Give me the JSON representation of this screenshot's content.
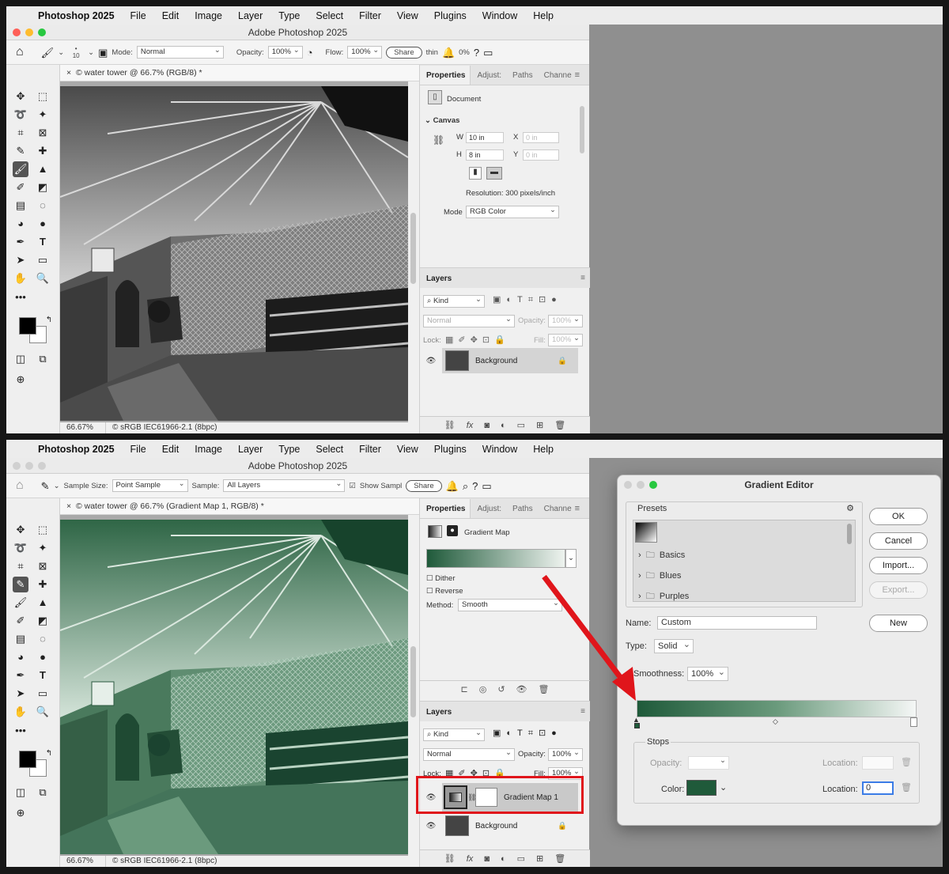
{
  "menubar": {
    "app_name": "Photoshop 2025",
    "items": [
      "File",
      "Edit",
      "Image",
      "Layer",
      "Type",
      "Select",
      "Filter",
      "View",
      "Plugins",
      "Window",
      "Help"
    ]
  },
  "window": {
    "title": "Adobe Photoshop 2025"
  },
  "top": {
    "options": {
      "brush_size": "10",
      "mode_label": "Mode:",
      "mode_value": "Normal",
      "opacity_label": "Opacity:",
      "opacity_value": "100%",
      "flow_label": "Flow:",
      "flow_value": "100%",
      "share": "Share",
      "thin_text": "thin",
      "smoothing_value": "0%"
    },
    "doc_tab": "© water tower @ 66.7% (RGB/8) *",
    "status": {
      "zoom": "66.67%",
      "profile": "© sRGB IEC61966-2.1 (8bpc)"
    },
    "panel_tabs": [
      "Properties",
      "Adjust:",
      "Paths",
      "Channe"
    ],
    "properties": {
      "document_label": "Document",
      "canvas_label": "Canvas",
      "w_label": "W",
      "w_value": "10 in",
      "h_label": "H",
      "h_value": "8 in",
      "x_label": "X",
      "x_value": "0 in",
      "y_label": "Y",
      "y_value": "0 in",
      "resolution": "Resolution: 300 pixels/inch",
      "mode_label": "Mode",
      "mode_value": "RGB Color"
    },
    "layers": {
      "tab": "Layers",
      "kind": "Kind",
      "blend": "Normal",
      "opacity_label": "Opacity:",
      "opacity_value": "100%",
      "lock_label": "Lock:",
      "fill_label": "Fill:",
      "fill_value": "100%",
      "rows": [
        "Background"
      ]
    }
  },
  "bottom": {
    "options": {
      "sample_size_label": "Sample Size:",
      "sample_size_value": "Point Sample",
      "sample_label": "Sample:",
      "sample_value": "All Layers",
      "show_sampling": "Show Sampl",
      "share": "Share"
    },
    "doc_tab": "© water tower @ 66.7% (Gradient Map 1, RGB/8) *",
    "status": {
      "zoom": "66.67%",
      "profile": "© sRGB IEC61966-2.1 (8bpc)"
    },
    "panel_tabs": [
      "Properties",
      "Adjust:",
      "Paths",
      "Channe"
    ],
    "properties": {
      "title": "Gradient Map",
      "dither": "Dither",
      "reverse": "Reverse",
      "method_label": "Method:",
      "method_value": "Smooth"
    },
    "layers": {
      "tab": "Layers",
      "kind": "Kind",
      "blend": "Normal",
      "opacity_label": "Opacity:",
      "opacity_value": "100%",
      "lock_label": "Lock:",
      "fill_label": "Fill:",
      "fill_value": "100%",
      "rows": [
        "Gradient Map 1",
        "Background"
      ]
    }
  },
  "gradient_editor": {
    "title": "Gradient Editor",
    "presets_label": "Presets",
    "folders": [
      "Basics",
      "Blues",
      "Purples"
    ],
    "buttons": {
      "ok": "OK",
      "cancel": "Cancel",
      "import": "Import...",
      "export": "Export...",
      "new": "New"
    },
    "name_label": "Name:",
    "name_value": "Custom",
    "type_label": "Type:",
    "type_value": "Solid",
    "smoothness_label": "Smoothness:",
    "smoothness_value": "100%",
    "stops_label": "Stops",
    "opacity_label": "Opacity:",
    "location_label": "Location:",
    "color_label": "Color:",
    "location_value": "0"
  },
  "colors": {
    "tint_green": "#2c6b45",
    "gradient_dark": "#1f5a3a",
    "annotation_red": "#e0151b"
  }
}
